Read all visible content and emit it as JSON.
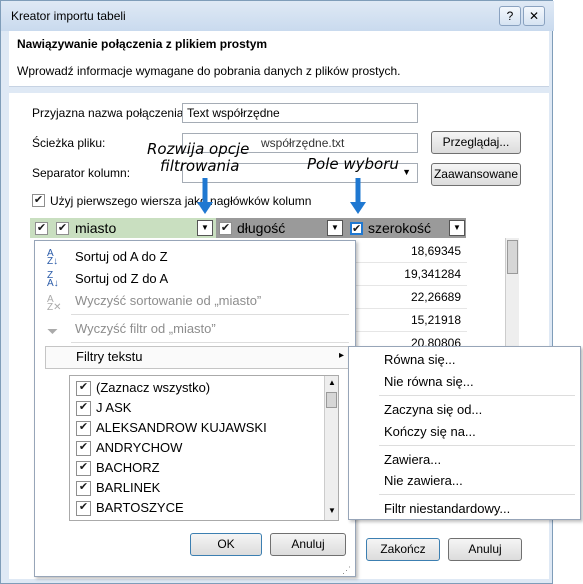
{
  "window": {
    "title": "Kreator importu tabeli",
    "help": "?",
    "close": "✕"
  },
  "header": {
    "title": "Nawiązywanie połączenia z plikiem prostym",
    "description": "Wprowadź informacje wymagane do pobrania danych z plików prostych."
  },
  "form": {
    "friendly_name_label": "Przyjazna nazwa połączenia:",
    "friendly_name_value": "Text współrzędne",
    "file_path_label": "Ścieżka pliku:",
    "file_path_value": "współrzędne.txt",
    "browse_button": "Przeglądaj...",
    "separator_label": "Separator kolumn:",
    "advanced_button": "Zaawansowane",
    "first_row_header_label": "Użyj pierwszego wiersza jako nagłówków kolumn"
  },
  "annotations": {
    "filter_callout_line1": "Rozwija opcje",
    "filter_callout_line2": "filtrowania",
    "checkbox_callout": "Pole wyboru"
  },
  "columns": {
    "miasto": "miasto",
    "dlugosc": "długość",
    "szerokosc": "szerokość"
  },
  "values": [
    "18,69345",
    "19,341284",
    "22,26689",
    "15,21918",
    "20,80806"
  ],
  "menu": {
    "sort_az": "Sortuj od A do Z",
    "sort_za": "Sortuj od Z do A",
    "clear_sort": "Wyczyść sortowanie od „miasto”",
    "clear_filter": "Wyczyść filtr od „miasto”",
    "text_filters": "Filtry tekstu",
    "items": [
      "(Zaznacz wszystko)",
      "J ASK",
      "ALEKSANDROW KUJAWSKI",
      "ANDRYCHOW",
      "BACHORZ",
      "BARLINEK",
      "BARTOSZYCE"
    ],
    "ok": "OK",
    "cancel": "Anuluj"
  },
  "submenu": {
    "equals": "Równa się...",
    "not_equals": "Nie równa się...",
    "begins_with": "Zaczyna się od...",
    "ends_with": "Kończy się na...",
    "contains": "Zawiera...",
    "not_contains": "Nie zawiera...",
    "custom": "Filtr niestandardowy..."
  },
  "footer": {
    "finish": "Zakończ",
    "cancel": "Anuluj"
  },
  "colors": {
    "accent": "#1f78d1",
    "window_bg": "#dfe9f5",
    "header_row": "#9a9a9a"
  }
}
